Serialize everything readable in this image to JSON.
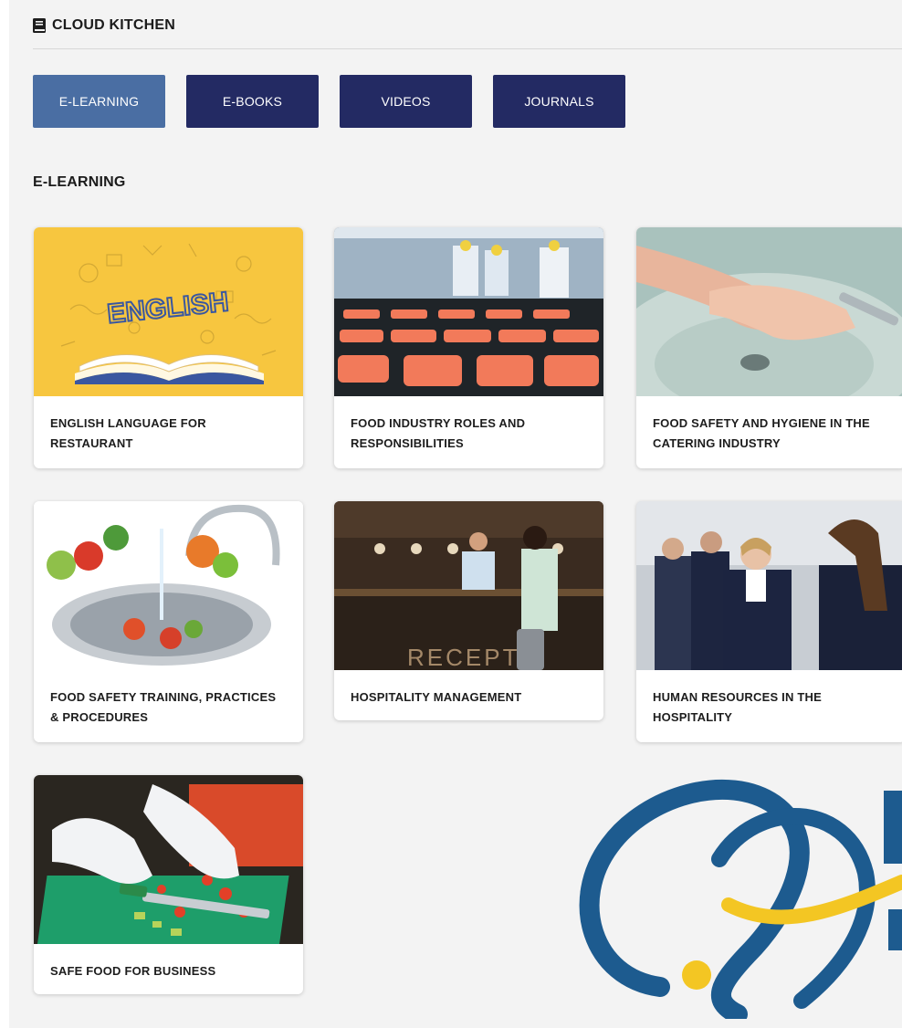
{
  "header": {
    "title": "CLOUD KITCHEN",
    "icon": "book-icon"
  },
  "tabs": [
    {
      "label": "E-LEARNING",
      "active": true
    },
    {
      "label": "E-BOOKS",
      "active": false
    },
    {
      "label": "VIDEOS",
      "active": false
    },
    {
      "label": "JOURNALS",
      "active": false
    }
  ],
  "section": {
    "title": "E-LEARNING"
  },
  "courses": [
    {
      "title": "ENGLISH LANGUAGE FOR RESTAURANT",
      "image": "english-book-illustration",
      "image_word": "ENGLISH"
    },
    {
      "title": "FOOD INDUSTRY ROLES AND RESPONSIBILITIES",
      "image": "salmon-factory-photo"
    },
    {
      "title": "FOOD SAFETY AND HYGIENE IN THE CATERING INDUSTRY",
      "image": "hand-washing-photo"
    },
    {
      "title": "FOOD SAFETY TRAINING, PRACTICES & PROCEDURES",
      "image": "vegetable-sink-photo"
    },
    {
      "title": "HOSPITALITY MANAGEMENT",
      "image": "hotel-reception-photo",
      "image_word": "RECEPT"
    },
    {
      "title": "HUMAN RESOURCES IN THE HOSPITALITY",
      "image": "hotel-staff-photo"
    },
    {
      "title": "SAFE FOOD FOR BUSINESS",
      "image": "chopping-peppers-photo"
    }
  ],
  "colors": {
    "tab": "#232a63",
    "tab_active": "#4a6ea3",
    "logo_blue": "#1d5b8f",
    "logo_yellow": "#f3c623"
  },
  "logo": {
    "icon": "partner-logo-mark"
  }
}
